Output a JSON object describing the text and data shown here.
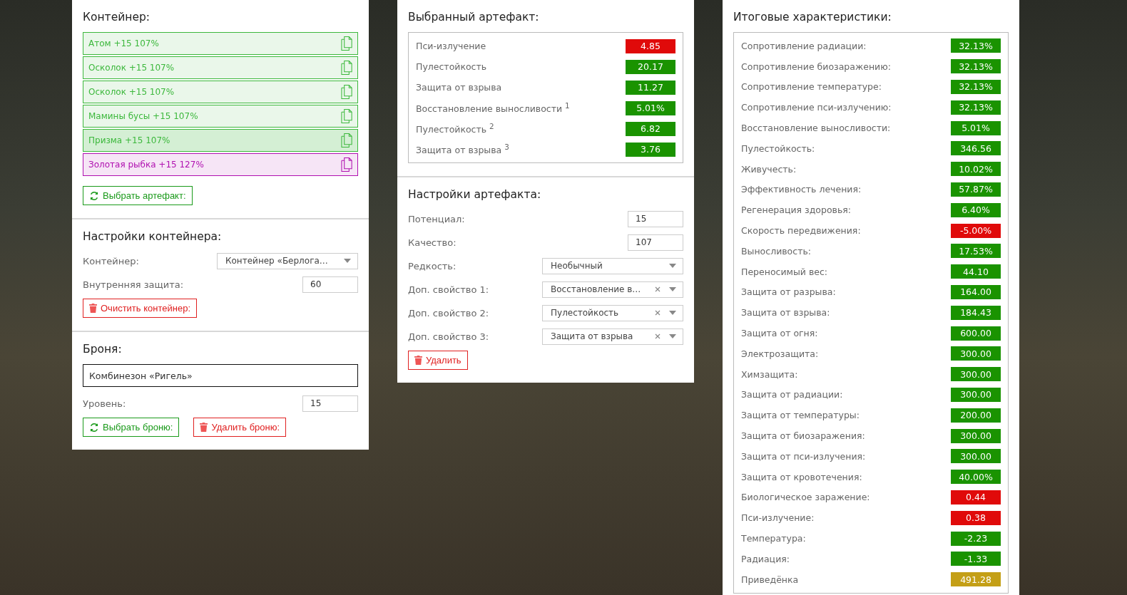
{
  "container_panel": {
    "title": "Контейнер:",
    "artifacts": [
      {
        "label": "Атом +15 107%",
        "color": "#3cb83c",
        "selected": false
      },
      {
        "label": "Осколок +15 107%",
        "color": "#3cb83c",
        "selected": false
      },
      {
        "label": "Осколок +15 107%",
        "color": "#3cb83c",
        "selected": false
      },
      {
        "label": "Мамины бусы +15 107%",
        "color": "#3cb83c",
        "selected": false
      },
      {
        "label": "Призма +15 107%",
        "color": "#3cb83c",
        "selected": true
      },
      {
        "label": "Золотая рыбка +15 127%",
        "color": "#b010b0",
        "selected": false
      }
    ],
    "select_button": "Выбрать артефакт:"
  },
  "container_settings": {
    "title": "Настройки контейнера:",
    "fields": [
      {
        "kind": "select",
        "label": "Контейнер:",
        "value": "Контейнер «Берлога…",
        "clearable": false
      },
      {
        "kind": "input",
        "label": "Внутренняя защита:",
        "value": "60"
      }
    ],
    "clear_button": "Очистить контейнер:"
  },
  "armor": {
    "title": "Броня:",
    "name": "Комбинезон «Ригель»",
    "fields": [
      {
        "kind": "input",
        "label": "Уровень:",
        "value": "15"
      }
    ],
    "select_button": "Выбрать броню:",
    "delete_button": "Удалить броню:"
  },
  "selected_artifact": {
    "title": "Выбранный артефакт:",
    "stats": [
      {
        "label": "Пси-излучение",
        "value": "4.85",
        "color": "#e00a0a"
      },
      {
        "label": "Пулестойкость",
        "value": "20.17",
        "color": "#1a9300"
      },
      {
        "label": "Защита от взрыва",
        "value": "11.27",
        "color": "#1a9300"
      },
      {
        "label": "Восстановление выносливости $^{1}$",
        "value": "5.01%",
        "color": "#1a9300"
      },
      {
        "label": "Пулестойкость $^{2}$",
        "value": "6.82",
        "color": "#1a9300"
      },
      {
        "label": "Защита от взрыва $^{3}$",
        "value": "3.76",
        "color": "#1a9300"
      }
    ]
  },
  "artifact_settings": {
    "title": "Настройки артефакта:",
    "fields": [
      {
        "kind": "input",
        "label": "Потенциал:",
        "value": "15"
      },
      {
        "kind": "input",
        "label": "Качество:",
        "value": "107"
      },
      {
        "kind": "select",
        "label": "Редкость:",
        "value": "Необычный",
        "clearable": false
      },
      {
        "kind": "select",
        "label": "Доп. свойство 1:",
        "value": "Восстановление в…",
        "clearable": true
      },
      {
        "kind": "select",
        "label": "Доп. свойство 2:",
        "value": "Пулестойкость",
        "clearable": true
      },
      {
        "kind": "select",
        "label": "Доп. свойство 3:",
        "value": "Защита от взрыва",
        "clearable": true
      }
    ],
    "delete_button": "Удалить"
  },
  "totals": {
    "title": "Итоговые характеристики:",
    "stats": [
      {
        "label": "Сопротивление радиации:",
        "value": "32.13%",
        "color": "#1a9300"
      },
      {
        "label": "Сопротивление биозаражению:",
        "value": "32.13%",
        "color": "#1a9300"
      },
      {
        "label": "Сопротивление температуре:",
        "value": "32.13%",
        "color": "#1a9300"
      },
      {
        "label": "Сопротивление пси-излучению:",
        "value": "32.13%",
        "color": "#1a9300"
      },
      {
        "label": "Восстановление выносливости:",
        "value": "5.01%",
        "color": "#1a9300"
      },
      {
        "label": "Пулестойкость:",
        "value": "346.56",
        "color": "#1a9300"
      },
      {
        "label": "Живучесть:",
        "value": "10.02%",
        "color": "#1a9300"
      },
      {
        "label": "Эффективность лечения:",
        "value": "57.87%",
        "color": "#1a9300"
      },
      {
        "label": "Регенерация здоровья:",
        "value": "6.40%",
        "color": "#1a9300"
      },
      {
        "label": "Скорость передвижения:",
        "value": "-5.00%",
        "color": "#e00a0a"
      },
      {
        "label": "Выносливость:",
        "value": "17.53%",
        "color": "#1a9300"
      },
      {
        "label": "Переносимый вес:",
        "value": "44.10",
        "color": "#1a9300"
      },
      {
        "label": "Защита от разрыва:",
        "value": "164.00",
        "color": "#1a9300"
      },
      {
        "label": "Защита от взрыва:",
        "value": "184.43",
        "color": "#1a9300"
      },
      {
        "label": "Защита от огня:",
        "value": "600.00",
        "color": "#1a9300"
      },
      {
        "label": "Электрозащита:",
        "value": "300.00",
        "color": "#1a9300"
      },
      {
        "label": "Химзащита:",
        "value": "300.00",
        "color": "#1a9300"
      },
      {
        "label": "Защита от радиации:",
        "value": "300.00",
        "color": "#1a9300"
      },
      {
        "label": "Защита от температуры:",
        "value": "200.00",
        "color": "#1a9300"
      },
      {
        "label": "Защита от биозаражения:",
        "value": "300.00",
        "color": "#1a9300"
      },
      {
        "label": "Защита от пси-излучения:",
        "value": "300.00",
        "color": "#1a9300"
      },
      {
        "label": "Защита от кровотечения:",
        "value": "40.00%",
        "color": "#1a9300"
      },
      {
        "label": "Биологическое заражение:",
        "value": "0.44",
        "color": "#e00a0a"
      },
      {
        "label": "Пси-излучение:",
        "value": "0.38",
        "color": "#e00a0a"
      },
      {
        "label": "Температура:",
        "value": "-2.23",
        "color": "#1a9300"
      },
      {
        "label": "Радиация:",
        "value": "-1.33",
        "color": "#1a9300"
      },
      {
        "label": "Приведёнка",
        "value": "491.28",
        "color": "#c49f16"
      }
    ]
  }
}
